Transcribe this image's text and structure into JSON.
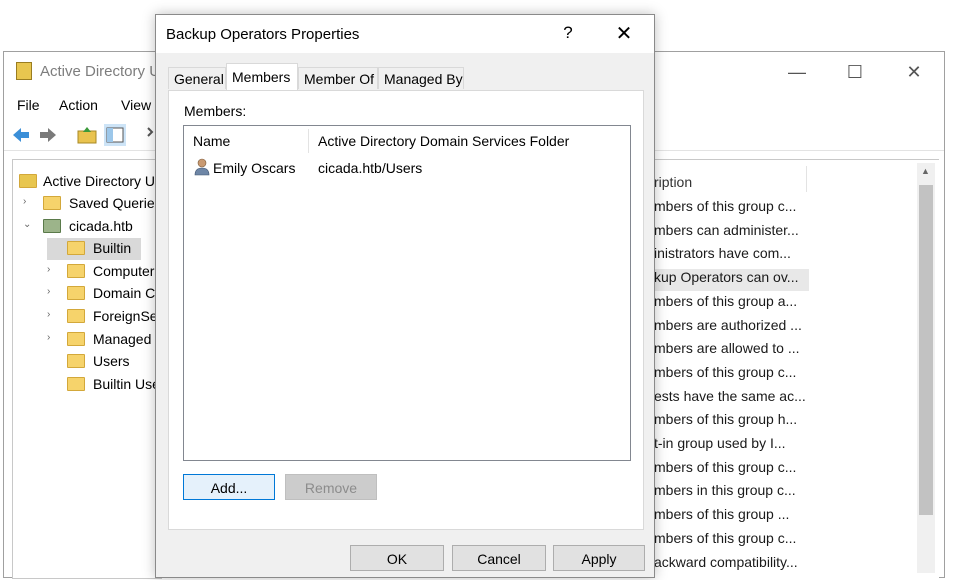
{
  "background_window": {
    "title": "Active Directory U",
    "menu": [
      "File",
      "Action",
      "View"
    ],
    "tree": [
      {
        "label": "Active Directory U",
        "expander": ""
      },
      {
        "label": "Saved Queries",
        "expander": "›"
      },
      {
        "label": "cicada.htb",
        "expander": "⌄"
      },
      {
        "label": "Builtin",
        "expander": ""
      },
      {
        "label": "Computers",
        "expander": "›"
      },
      {
        "label": "Domain Co",
        "expander": "›"
      },
      {
        "label": "ForeignSe",
        "expander": "›"
      },
      {
        "label": "Managed",
        "expander": "›"
      },
      {
        "label": "Users",
        "expander": ""
      },
      {
        "label": "Builtin Use",
        "expander": ""
      }
    ],
    "list_header": "ription",
    "descriptions": [
      "mbers of this group c...",
      "mbers can administer...",
      "inistrators have com...",
      "kup Operators can ov...",
      "mbers of this group a...",
      "mbers are authorized ...",
      "mbers are allowed to ...",
      "mbers of this group c...",
      "ests have the same ac...",
      "mbers of this group h...",
      "t-in group used by I...",
      "mbers of this group c...",
      "mbers in this group c...",
      "mbers of this group ...",
      "mbers of this group c...",
      "ackward compatibility..."
    ]
  },
  "dialog": {
    "title": "Backup Operators Properties",
    "help": "?",
    "close": "✕",
    "tabs": [
      "General",
      "Members",
      "Member Of",
      "Managed By"
    ],
    "active_tab": "Members",
    "members_label": "Members:",
    "columns": [
      "Name",
      "Active Directory Domain Services Folder"
    ],
    "members": [
      {
        "name": "Emily Oscars",
        "folder": "cicada.htb/Users"
      }
    ],
    "add_label": "Add...",
    "remove_label": "Remove",
    "ok_label": "OK",
    "cancel_label": "Cancel",
    "apply_label": "Apply"
  },
  "colors": {
    "folder": "#f6d36b",
    "accent_border": "#0078d7",
    "dialog_bg": "#f0f0f0"
  }
}
